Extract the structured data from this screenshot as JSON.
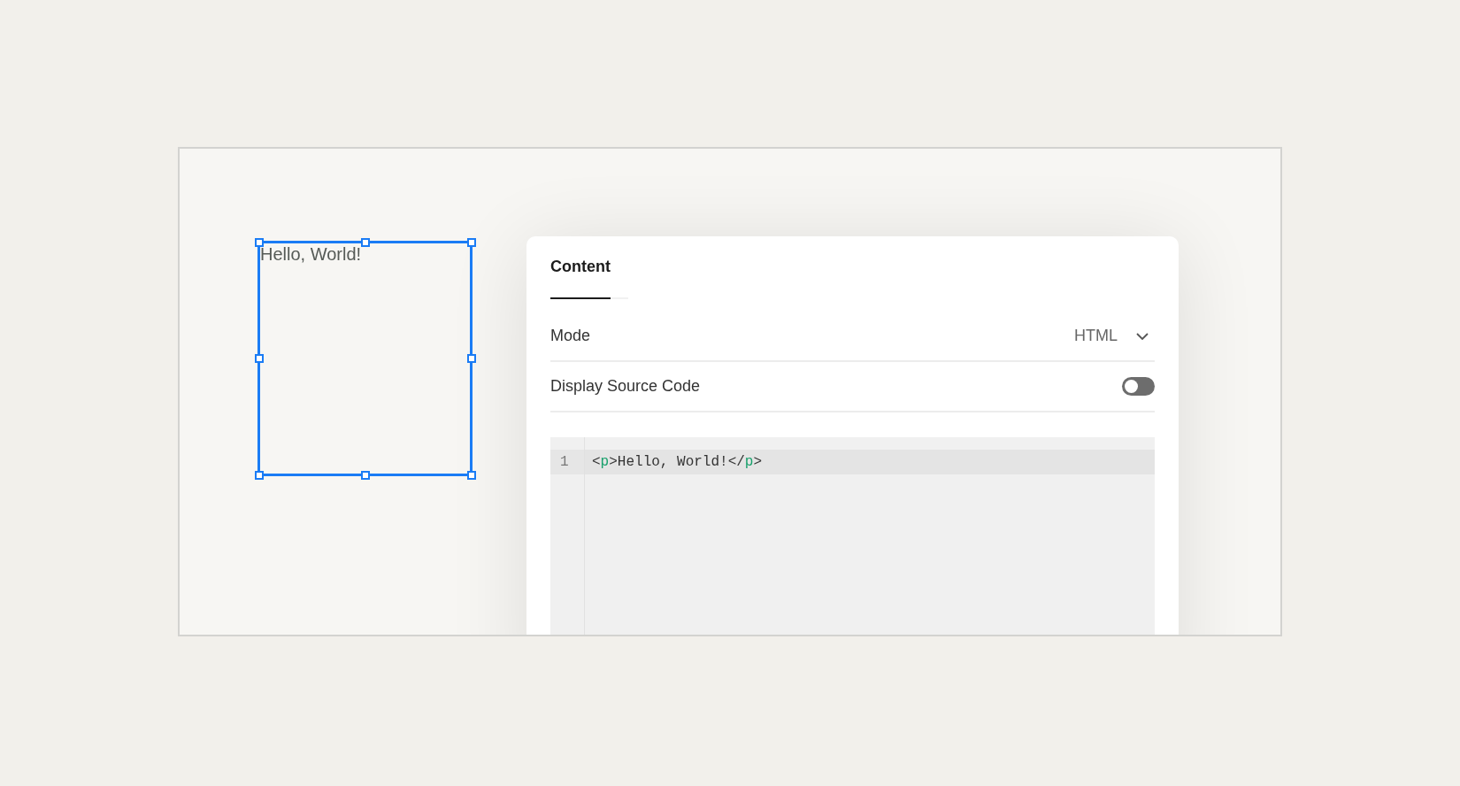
{
  "canvas": {
    "text_block": {
      "text": "Hello, World!",
      "selected": true
    }
  },
  "panel": {
    "tabs": [
      {
        "label": "Content",
        "selected": true
      }
    ],
    "settings": [
      {
        "kind": "dropdown",
        "label": "Mode",
        "value": "HTML"
      },
      {
        "kind": "toggle",
        "label": "Display Source Code",
        "on": false
      }
    ],
    "code_editor": {
      "lines": [
        {
          "number": "1",
          "active": true,
          "tokens": [
            {
              "kind": "punct",
              "text": "<"
            },
            {
              "kind": "tag",
              "text": "p"
            },
            {
              "kind": "punct",
              "text": ">"
            },
            {
              "kind": "text",
              "text": "Hello, World!"
            },
            {
              "kind": "punct",
              "text": "</"
            },
            {
              "kind": "tag",
              "text": "p"
            },
            {
              "kind": "punct",
              "text": ">"
            }
          ]
        }
      ]
    }
  }
}
